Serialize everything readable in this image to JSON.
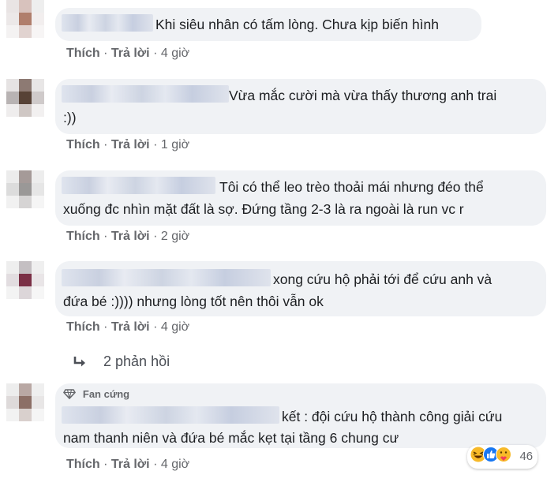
{
  "comments": [
    {
      "text": "Khi siêu nhân có tấm lòng. Chưa kịp biến hình",
      "like": "Thích",
      "reply": "Trả lời",
      "time": "4 giờ"
    },
    {
      "text": "Vừa mắc cười mà vừa thấy thương anh trai",
      "text2": ":))",
      "like": "Thích",
      "reply": "Trả lời",
      "time": "1 giờ"
    },
    {
      "text": "Tôi có thể leo trèo thoải mái nhưng đéo thể",
      "text2": "xuống đc nhìn mặt đất là sợ. Đứng tầng 2-3 là ra ngoài là run vc r",
      "like": "Thích",
      "reply": "Trả lời",
      "time": "2 giờ"
    },
    {
      "text": "xong cứu hộ phải tới để cứu anh và",
      "text2": "đứa bé :)))) nhưng lòng tốt nên thôi vẫn ok",
      "like": "Thích",
      "reply": "Trả lời",
      "time": "4 giờ"
    },
    {
      "badge": "Fan cứng",
      "text": "kết : đội cứu hộ thành công giải cứu",
      "text2": "nam thanh niên và đứa bé mắc kẹt tại tầng 6 chung cư",
      "like": "Thích",
      "reply": "Trả lời",
      "time": "4 giờ",
      "reaction_count": "46"
    }
  ],
  "replies_link": {
    "label": "2 phản hồi"
  },
  "icons": {
    "reply_arrow": "reply-arrow-icon",
    "diamond": "diamond-icon",
    "reactions": [
      "haha",
      "like",
      "care"
    ]
  },
  "colors": {
    "bubble": "#f0f2f5",
    "action_text": "#65676b",
    "reaction_like": "#1877f2",
    "reaction_haha": "#f7b928"
  }
}
